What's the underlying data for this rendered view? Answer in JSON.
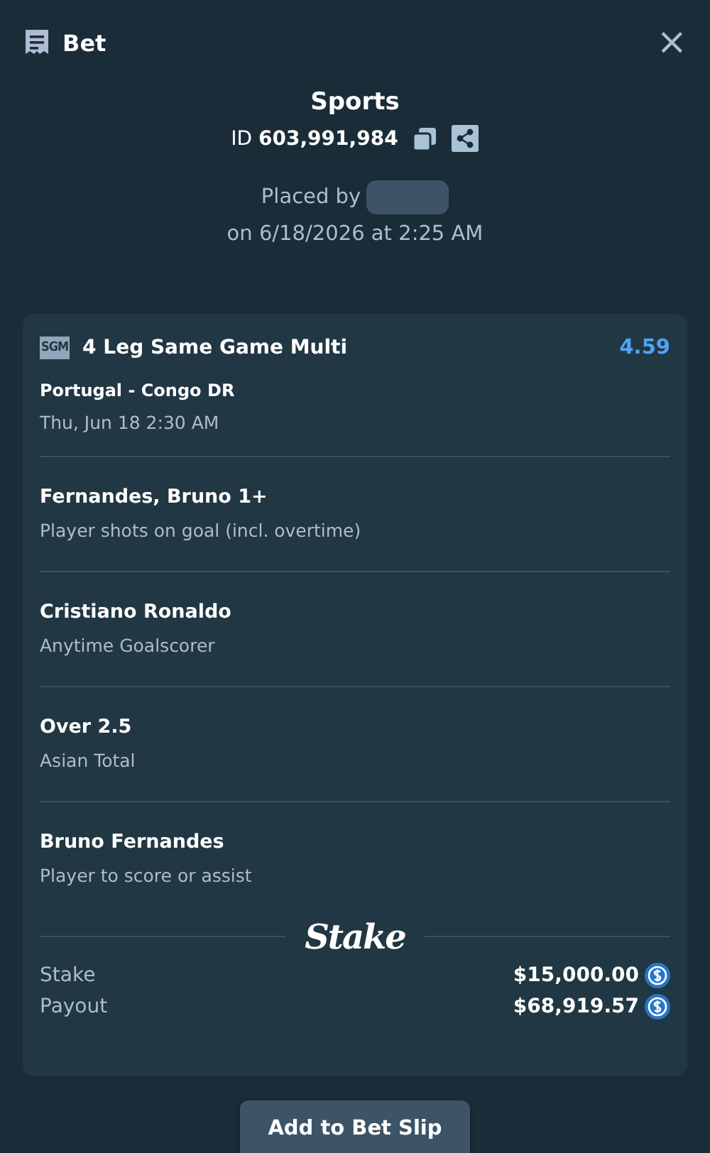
{
  "header": {
    "title": "Bet",
    "close": "×"
  },
  "summary": {
    "title": "Sports",
    "id_label": "ID",
    "id_value": "603,991,984",
    "placed_by": "Placed by",
    "placed_on": "on 6/18/2026 at 2:25 AM"
  },
  "bet": {
    "badge": "SGM",
    "name": "4 Leg Same Game Multi",
    "odds": "4.59",
    "event": "Portugal - Congo DR",
    "event_time": "Thu, Jun 18 2:30 AM",
    "legs": [
      {
        "selection": "Fernandes, Bruno 1+",
        "market": "Player shots on goal (incl. overtime)"
      },
      {
        "selection": "Cristiano Ronaldo",
        "market": "Anytime Goalscorer"
      },
      {
        "selection": "Over 2.5",
        "market": "Asian Total"
      },
      {
        "selection": "Bruno Fernandes",
        "market": "Player to score or assist"
      }
    ],
    "logo": "Stake",
    "amounts": [
      {
        "label": "Stake",
        "value": "$15,000.00"
      },
      {
        "label": "Payout",
        "value": "$68,919.57"
      }
    ]
  },
  "actions": [
    {
      "label": "Add to Bet Slip"
    }
  ]
}
